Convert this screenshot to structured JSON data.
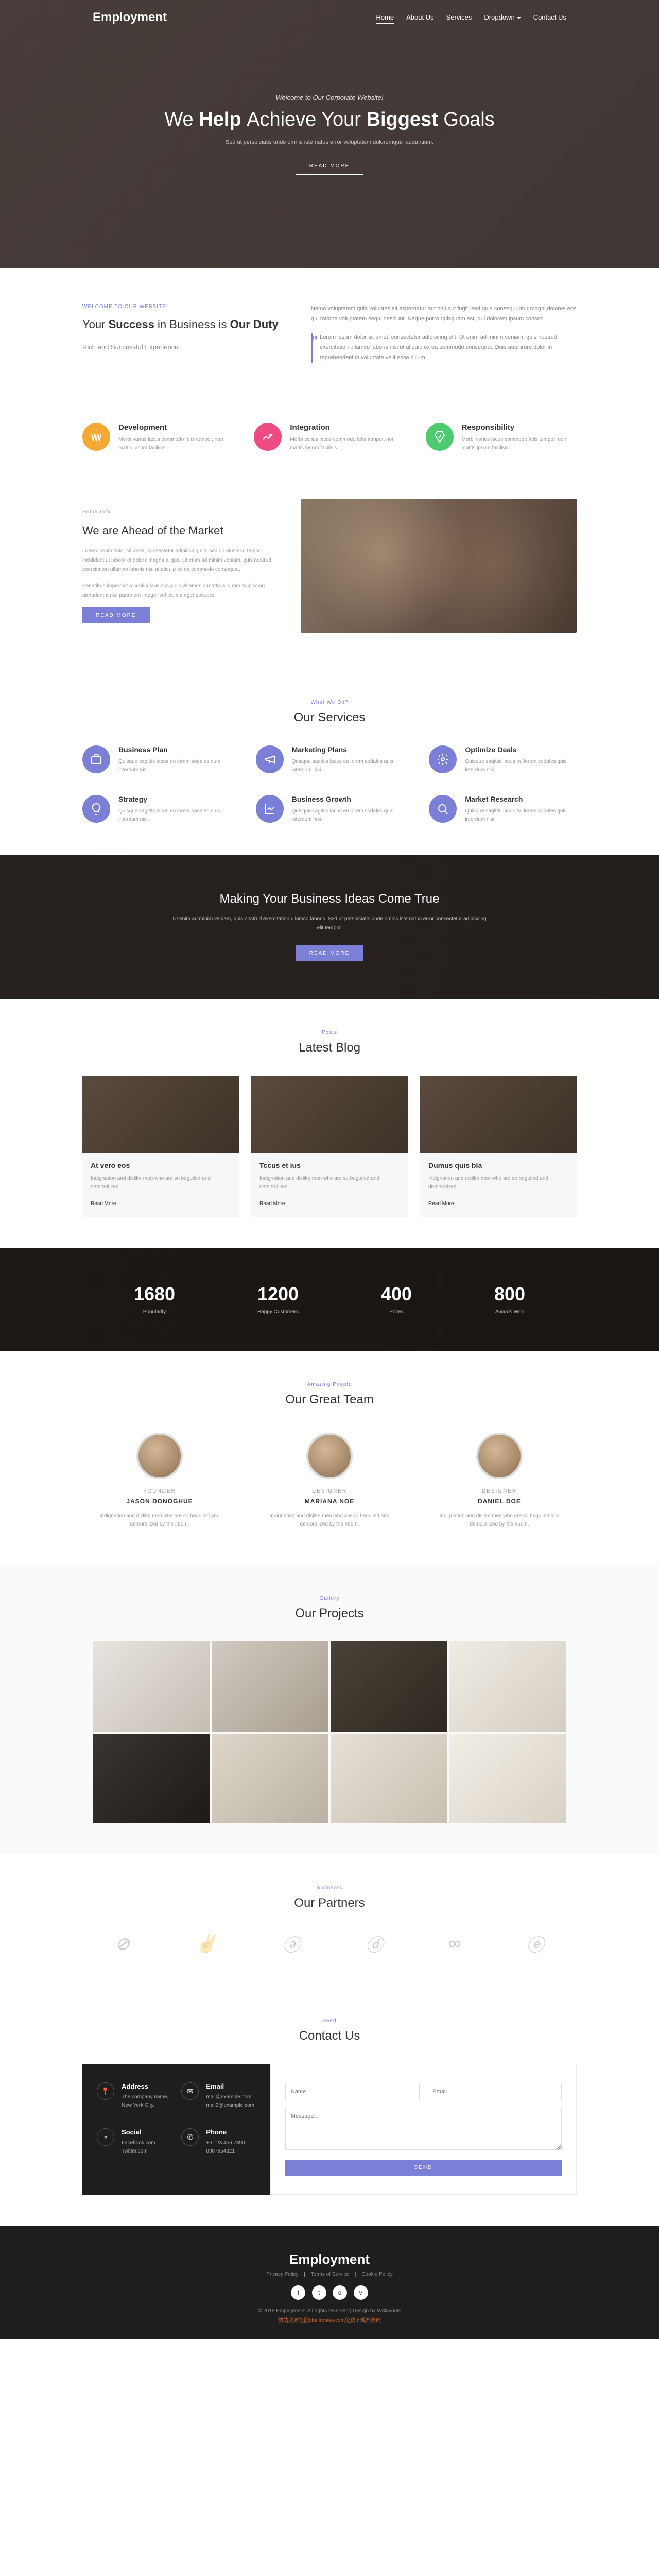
{
  "brand": "Employment",
  "nav": [
    {
      "label": "Home",
      "active": true
    },
    {
      "label": "About Us",
      "active": false
    },
    {
      "label": "Services",
      "active": false
    },
    {
      "label": "Dropdown",
      "active": false,
      "dropdown": true
    },
    {
      "label": "Contact Us",
      "active": false
    }
  ],
  "hero": {
    "sub": "Welcome to Our Corporate Website!",
    "title_pre": "We ",
    "title_b1": "Help ",
    "title_mid": "Achieve Your ",
    "title_b2": "Biggest ",
    "title_end": "Goals",
    "desc": "Sed ut perspiciatis unde omnis iste natus error voluptatem doloremque laudantium.",
    "btn": "Read More"
  },
  "intro": {
    "eyebrow": "WELCOME TO OUR WEBSITE!",
    "h_pre": "Your ",
    "h_b1": "Success ",
    "h_mid": "in Business is ",
    "h_b2": "Our Duty",
    "tag": "Rich and Successful Experience",
    "p1": "Nemo voluptatem quia voluptas sit aspernatur aut odit aut fugit, sed quia consequuntur magni dolores eos qui ratione voluptatem sequi nesciunt. Neque porro quisquam est, qui dolorem ipsum consec.",
    "quote": "Lorem ipsum dolor sit amet, consectetur adipiscing elit. Ut enim ad minim veniam, quis nostrud exercitation ullamco laboris nisi ut aliquip ex ea commodo consequat. Duis aute irure dolor in reprehenderit in voluptate velit esse cillum."
  },
  "features": [
    {
      "title": "Development",
      "desc": "Morbi varius lacus commodo felis tempor, non mattis ipsum facilisis.",
      "color": "orange"
    },
    {
      "title": "Integration",
      "desc": "Morbi varius lacus commodo felis tempor, non mattis ipsum facilisis.",
      "color": "pink"
    },
    {
      "title": "Responsibility",
      "desc": "Morbi varius lacus commodo felis tempor, non mattis ipsum facilisis.",
      "color": "green"
    }
  ],
  "ahead": {
    "eyebrow": "Some Info",
    "title": "We are Ahead of the Market",
    "p1": "Lorem ipsum dolor sit amet, consectetur adipiscing elit, sed do eiusmod tempor incididunt ut labore et dolore magna aliqua. Ut enim ad minim veniam, quis nostrud exercitation ullamco laboris nisi ut aliquip ex ea commodo consequat.",
    "p2": "Penatibus imperdiet a cubilia faucibus a dis vivamus a mattis aliquam adipiscing parturient a nisi parturient integer vehicula a eget posuere.",
    "btn": "Read More"
  },
  "services": {
    "eyebrow": "What We Do?",
    "title": "Our Services",
    "items": [
      {
        "title": "Business Plan",
        "desc": "Quisque sagittis lacus eu lorem sodales quis interdum nisi."
      },
      {
        "title": "Marketing Plans",
        "desc": "Quisque sagittis lacus eu lorem sodales quis interdum nisi."
      },
      {
        "title": "Optimize Deals",
        "desc": "Quisque sagittis lacus eu lorem sodales quis interdum nisi."
      },
      {
        "title": "Strategy",
        "desc": "Quisque sagittis lacus eu lorem sodales quis interdum nisi."
      },
      {
        "title": "Business Growth",
        "desc": "Quisque sagittis lacus eu lorem sodales quis interdum nisi."
      },
      {
        "title": "Market Research",
        "desc": "Quisque sagittis lacus eu lorem sodales quis interdum nisi."
      }
    ]
  },
  "cta": {
    "title": "Making Your Business Ideas Come True",
    "desc": "Ut enim ad minim veniam, quis nostrud exercitation ullamco laboris. Sed ut perspiciatis unde omnis iste natus error consectetur adipiscing elit tempor.",
    "btn": "Read More"
  },
  "blog": {
    "eyebrow": "Posts",
    "title": "Latest Blog",
    "items": [
      {
        "title": "At vero eos",
        "desc": "Indignation and dislike men who are so beguiled and demoralized.",
        "link": "Read More"
      },
      {
        "title": "Tccus et ius",
        "desc": "Indignation and dislike men who are so beguiled and demoralized.",
        "link": "Read More"
      },
      {
        "title": "Dumus quis bla",
        "desc": "Indignation and dislike men who are so beguiled and demoralized.",
        "link": "Read More"
      }
    ]
  },
  "stats": [
    {
      "num": "1680",
      "label": "Popularity"
    },
    {
      "num": "1200",
      "label": "Happy Customers"
    },
    {
      "num": "400",
      "label": "Prizes"
    },
    {
      "num": "800",
      "label": "Awards Won"
    }
  ],
  "team": {
    "eyebrow": "Amazing People",
    "title": "Our Great Team",
    "members": [
      {
        "role": "FOUNDER",
        "name": "JASON DONOGHUE",
        "desc": "Indignation and dislike men who are so beguiled and demoralized by the #50m."
      },
      {
        "role": "DESIGNER",
        "name": "MARIANA NOE",
        "desc": "Indignation and dislike men who are so beguiled and demoralized by the #50m."
      },
      {
        "role": "DESIGNER",
        "name": "DANIEL DOE",
        "desc": "Indignation and dislike men who are so beguiled and demoralized by the #50m."
      }
    ]
  },
  "projects": {
    "eyebrow": "Gallery",
    "title": "Our Projects"
  },
  "partners": {
    "eyebrow": "Sponsors",
    "title": "Our Partners"
  },
  "contact": {
    "eyebrow": "Send",
    "title": "Contact Us",
    "info": [
      {
        "h": "Address",
        "l1": "The company name,",
        "l2": "New York City."
      },
      {
        "h": "Email",
        "l1": "mail@example.com",
        "l2": "mail2@example.com"
      },
      {
        "h": "Social",
        "l1": "Facebook.com",
        "l2": "Twitter.com"
      },
      {
        "h": "Phone",
        "l1": "+0 123 456 7890",
        "l2": "0987654321"
      }
    ],
    "ph_name": "Name",
    "ph_email": "Email",
    "ph_msg": "Message...",
    "btn": "Send"
  },
  "footer": {
    "brand": "Employment",
    "policies": [
      "Privacy Policy",
      "Terms of Service",
      "Cookie Policy"
    ],
    "copy": "© 2018 Employment. All rights reserved | Design by W3layouts",
    "watermark": "仿站资源社区bbs.irenwo.com免费下载开源码"
  }
}
